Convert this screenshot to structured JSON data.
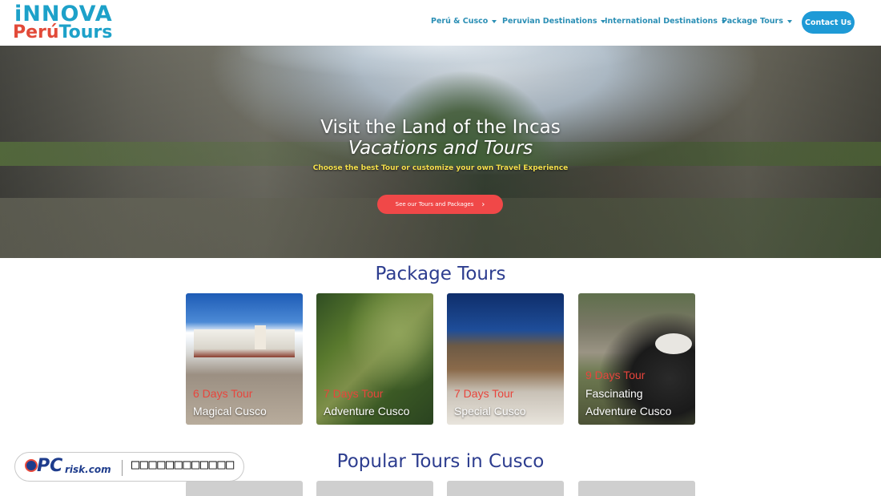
{
  "header": {
    "logo": {
      "line1": "iNNOVA",
      "line2a": "Perú",
      "line2b": "Tours"
    },
    "nav": [
      {
        "label": "Perú & Cusco"
      },
      {
        "label": "Peruvian Destinations"
      },
      {
        "label": "International Destinations"
      },
      {
        "label": "Package Tours"
      }
    ],
    "contact_label": "Contact Us"
  },
  "hero": {
    "title": "Visit the Land of the Incas",
    "subtitle": "Vacations and Tours",
    "tagline": "Choose the best Tour or customize your own Travel Experience",
    "button_label": "See our Tours and Packages",
    "button_icon": "chevron-right-icon"
  },
  "package_section": {
    "title": "Package Tours",
    "cards": [
      {
        "days": "6 Days Tour",
        "name_line1": "Magical Cusco",
        "name_line2": ""
      },
      {
        "days": "7 Days Tour",
        "name_line1": "Adventure Cusco",
        "name_line2": ""
      },
      {
        "days": "7 Days Tour",
        "name_line1": "Special Cusco",
        "name_line2": ""
      },
      {
        "days": "9 Days Tour",
        "name_line1": "Fascinating",
        "name_line2": "Adventure Cusco"
      }
    ]
  },
  "popular_section": {
    "title": "Popular Tours in Cusco"
  },
  "watermark": {
    "brand_pc": "PC",
    "brand_risk": "risk.com",
    "text": "□□□□□□□□□□□□"
  },
  "colors": {
    "nav_text": "#2b8fb5",
    "contact_button": "#1e9ad6",
    "hero_button": "#f04848",
    "section_title": "#2d3d8f",
    "days_label": "#e8453c",
    "tagline": "#f3e04a"
  }
}
